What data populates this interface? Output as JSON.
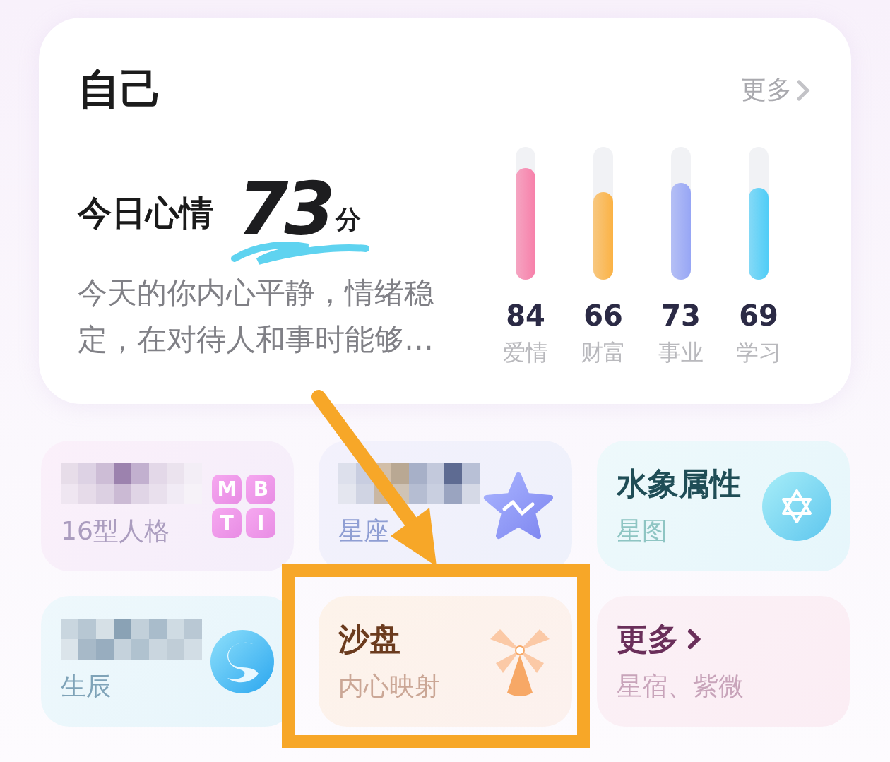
{
  "header": {
    "title": "自己",
    "more": "更多"
  },
  "mood": {
    "label": "今日心情",
    "score": "73",
    "unit": "分",
    "description": "今天的你内心平静，情绪稳定，在对待人和事时能够…"
  },
  "metrics": [
    {
      "value": "84",
      "label": "爱情",
      "level": 0.84,
      "color": "#f77fa9"
    },
    {
      "value": "66",
      "label": "财富",
      "level": 0.66,
      "color": "#fbb244"
    },
    {
      "value": "73",
      "label": "事业",
      "level": 0.73,
      "color": "#97a6f5"
    },
    {
      "value": "69",
      "label": "学习",
      "level": 0.69,
      "color": "#4fcdf7"
    }
  ],
  "tiles": [
    {
      "kind": "mbti",
      "subtitle": "16型人格",
      "icon_letters": [
        "M",
        "B",
        "T",
        "I"
      ],
      "highlighted": false
    },
    {
      "kind": "star",
      "subtitle": "星座",
      "highlighted": false
    },
    {
      "kind": "water",
      "title": "水象属性",
      "subtitle": "星图",
      "highlighted": false
    },
    {
      "kind": "swirl",
      "subtitle": "生辰",
      "highlighted": false
    },
    {
      "kind": "sandbox",
      "title": "沙盘",
      "subtitle": "内心映射",
      "highlighted": true
    },
    {
      "kind": "more",
      "title": "更多",
      "subtitle": "星宿、紫微",
      "highlighted": false
    }
  ]
}
